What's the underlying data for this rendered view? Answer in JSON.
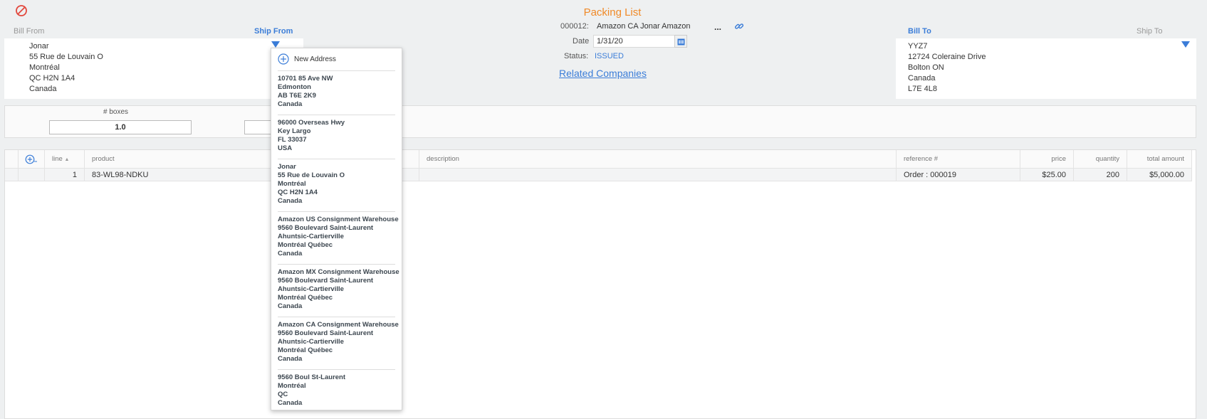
{
  "app": {
    "title": "Packing List"
  },
  "header": {
    "bill_from_label": "Bill From",
    "ship_from_label": "Ship From",
    "bill_to_label": "Bill To",
    "ship_to_label": "Ship To"
  },
  "bill_from": {
    "lines": [
      "Jonar",
      "55 Rue de Louvain O",
      "Montréal",
      "QC H2N 1A4",
      "Canada"
    ]
  },
  "bill_to": {
    "lines": [
      "YYZ7",
      "12724 Coleraine Drive",
      "Bolton ON",
      "Canada",
      "L7E 4L8"
    ]
  },
  "document": {
    "number_label": "000012:",
    "company": "Amazon CA Jonar Amazon",
    "more_label": "...",
    "date_label": "Date",
    "date_value": "1/31/20",
    "status_label": "Status:",
    "status_value": "ISSUED",
    "related_link": "Related Companies"
  },
  "boxes": {
    "label": "# boxes",
    "value": "1.0"
  },
  "grid": {
    "columns": [
      "line",
      "product",
      "description",
      "reference #",
      "price",
      "quantity",
      "total amount"
    ],
    "rows": [
      {
        "line": "1",
        "product": "83-WL98-NDKU",
        "description": "",
        "reference": "Order : 000019",
        "price": "$25.00",
        "quantity": "200",
        "total": "$5,000.00"
      }
    ]
  },
  "dropdown": {
    "new_address_label": "New Address",
    "addresses": [
      {
        "lines": [
          "10701 85 Ave NW",
          "Edmonton",
          "AB T6E 2K9",
          "Canada"
        ]
      },
      {
        "lines": [
          "96000 Overseas Hwy",
          "Key Largo",
          "FL 33037",
          "USA"
        ]
      },
      {
        "lines": [
          "Jonar",
          "55 Rue de Louvain O",
          "Montréal",
          "QC H2N 1A4",
          "Canada"
        ]
      },
      {
        "lines": [
          "Amazon US Consignment Warehouse",
          "9560 Boulevard Saint-Laurent",
          "Ahuntsic-Cartierville",
          "Montréal Québec",
          "Canada"
        ]
      },
      {
        "lines": [
          "Amazon MX Consignment Warehouse",
          "9560 Boulevard Saint-Laurent",
          "Ahuntsic-Cartierville",
          "Montréal Québec",
          "Canada"
        ]
      },
      {
        "lines": [
          "Amazon CA Consignment Warehouse",
          "9560 Boulevard Saint-Laurent",
          "Ahuntsic-Cartierville",
          "Montréal Québec",
          "Canada"
        ]
      },
      {
        "lines": [
          "9560 Boul St-Laurent",
          "Montréal",
          "QC",
          "Canada"
        ]
      }
    ]
  },
  "colors": {
    "accent": "#3b7dd8",
    "title": "#f08a28",
    "cancel": "#e2483d"
  },
  "icons": {
    "cancel": "cancel-icon",
    "calendar": "calendar-icon",
    "link": "link-icon",
    "add": "add-circle-icon",
    "dropdown": "triangle-down-icon"
  }
}
